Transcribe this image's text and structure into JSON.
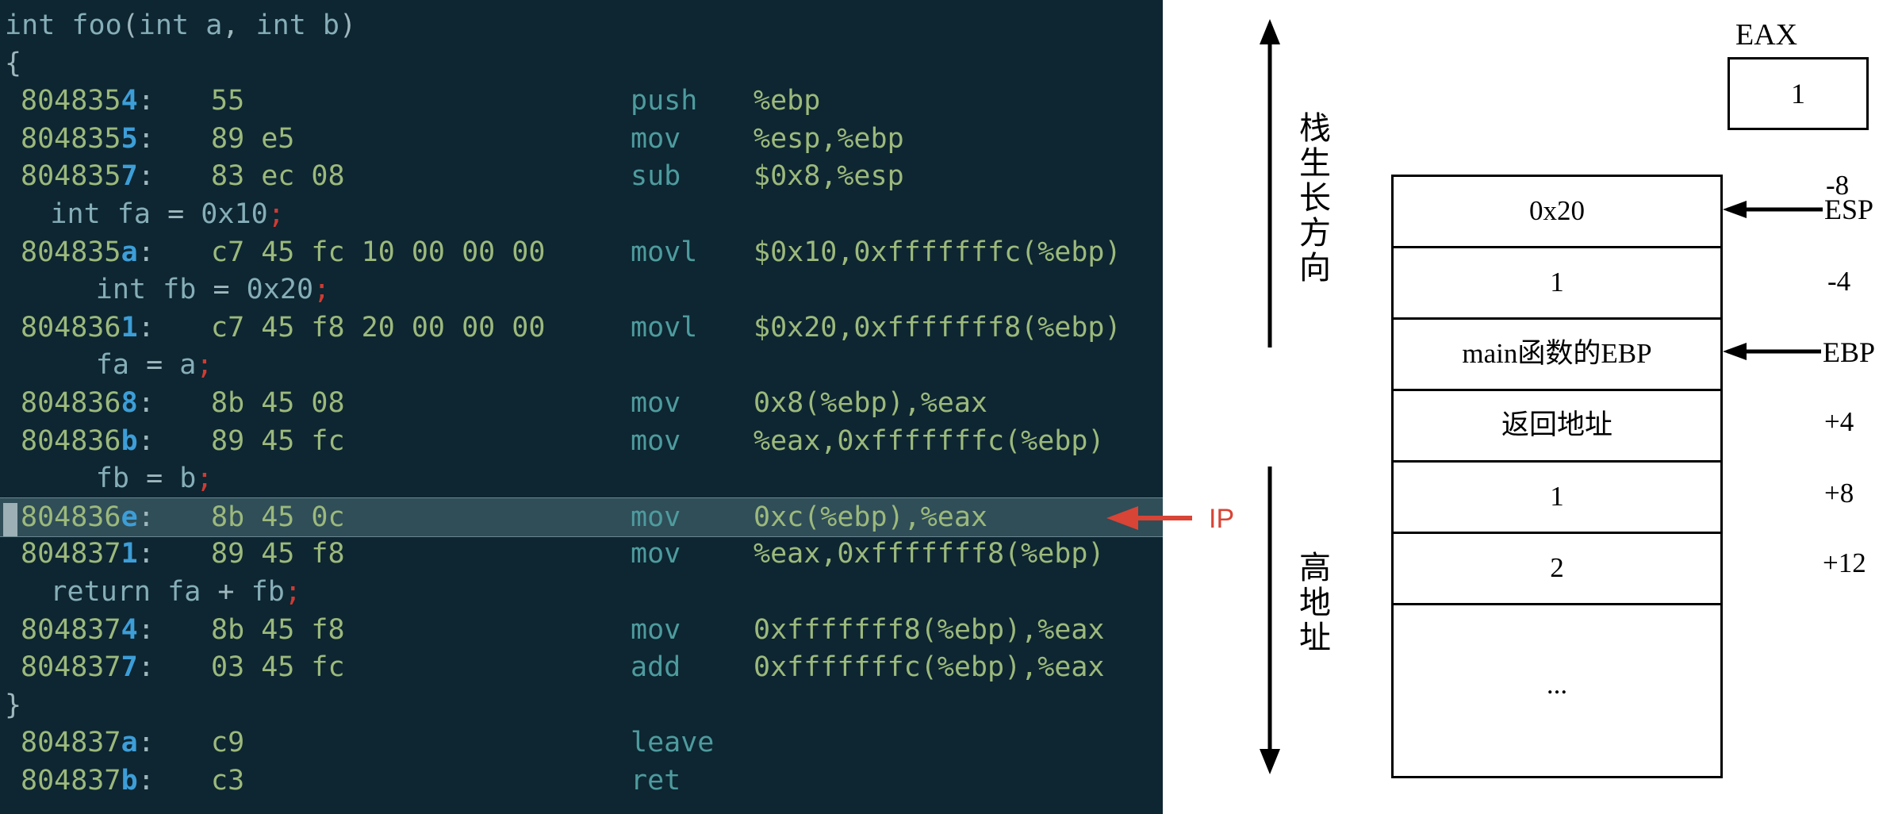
{
  "code": {
    "lines": [
      {
        "kind": "src",
        "indent": 0,
        "text": "int foo(int a, int b)"
      },
      {
        "kind": "src",
        "indent": 0,
        "text": "{"
      },
      {
        "kind": "asm",
        "addr": "804835",
        "addr_last": "4",
        "bytes": "55",
        "mnemonic": "push",
        "operands": "%ebp"
      },
      {
        "kind": "asm",
        "addr": "804835",
        "addr_last": "5",
        "bytes": "89 e5",
        "mnemonic": "mov",
        "operands": "%esp,%ebp"
      },
      {
        "kind": "asm",
        "addr": "804835",
        "addr_last": "7",
        "bytes": "83 ec 08",
        "mnemonic": "sub",
        "operands": "$0x8,%esp"
      },
      {
        "kind": "src",
        "indent": 4,
        "text": "int fa = 0x10;"
      },
      {
        "kind": "asm",
        "addr": "804835",
        "addr_last": "a",
        "bytes": "c7 45 fc 10 00 00 00",
        "mnemonic": "movl",
        "operands": "$0x10,0xfffffffc(%ebp)"
      },
      {
        "kind": "src",
        "indent": 8,
        "text": "int fb = 0x20;"
      },
      {
        "kind": "asm",
        "addr": "804836",
        "addr_last": "1",
        "bytes": "c7 45 f8 20 00 00 00",
        "mnemonic": "movl",
        "operands": "$0x20,0xfffffff8(%ebp)"
      },
      {
        "kind": "src",
        "indent": 8,
        "text": "fa = a;"
      },
      {
        "kind": "asm",
        "addr": "804836",
        "addr_last": "8",
        "bytes": "8b 45 08",
        "mnemonic": "mov",
        "operands": "0x8(%ebp),%eax"
      },
      {
        "kind": "asm",
        "addr": "804836",
        "addr_last": "b",
        "bytes": "89 45 fc",
        "mnemonic": "mov",
        "operands": "%eax,0xfffffffc(%ebp)"
      },
      {
        "kind": "src",
        "indent": 8,
        "text": "fb = b;"
      },
      {
        "kind": "asm",
        "addr": "804836",
        "addr_last": "e",
        "bytes": "8b 45 0c",
        "mnemonic": "mov",
        "operands": "0xc(%ebp),%eax",
        "highlight": true
      },
      {
        "kind": "asm",
        "addr": "804837",
        "addr_last": "1",
        "bytes": "89 45 f8",
        "mnemonic": "mov",
        "operands": "%eax,0xfffffff8(%ebp)"
      },
      {
        "kind": "src",
        "indent": 4,
        "text": "return fa + fb;"
      },
      {
        "kind": "asm",
        "addr": "804837",
        "addr_last": "4",
        "bytes": "8b 45 f8",
        "mnemonic": "mov",
        "operands": "0xfffffff8(%ebp),%eax"
      },
      {
        "kind": "asm",
        "addr": "804837",
        "addr_last": "7",
        "bytes": "03 45 fc",
        "mnemonic": "add",
        "operands": "0xfffffffc(%ebp),%eax"
      },
      {
        "kind": "src",
        "indent": 0,
        "text": "}"
      },
      {
        "kind": "asm",
        "addr": "804837",
        "addr_last": "a",
        "bytes": "c9",
        "mnemonic": "leave",
        "operands": ""
      },
      {
        "kind": "asm",
        "addr": "804837",
        "addr_last": "b",
        "bytes": "c3",
        "mnemonic": "ret",
        "operands": ""
      }
    ]
  },
  "ip_marker": {
    "label": "IP",
    "color": "#d84436"
  },
  "diagram": {
    "growth_label": "栈生长方向",
    "high_addr_label": "高地址",
    "eax": {
      "label": "EAX",
      "value": "1"
    },
    "cells": [
      {
        "value": "0x20",
        "offset": "-8"
      },
      {
        "value": "1",
        "offset": "-4"
      },
      {
        "value": "main函数的EBP",
        "offset": ""
      },
      {
        "value": "返回地址",
        "offset": "+4"
      },
      {
        "value": "1",
        "offset": "+8"
      },
      {
        "value": "2",
        "offset": "+12"
      },
      {
        "value": "...",
        "offset": ""
      }
    ],
    "esp_label": "ESP",
    "ebp_label": "EBP"
  },
  "colors": {
    "code_bg": "#0d2631",
    "address": "#9cb97c",
    "address_last": "#3d9ed8",
    "semicolon": "#d23a32",
    "highlight_row": "#2f4e58",
    "ip_arrow": "#d84436"
  }
}
